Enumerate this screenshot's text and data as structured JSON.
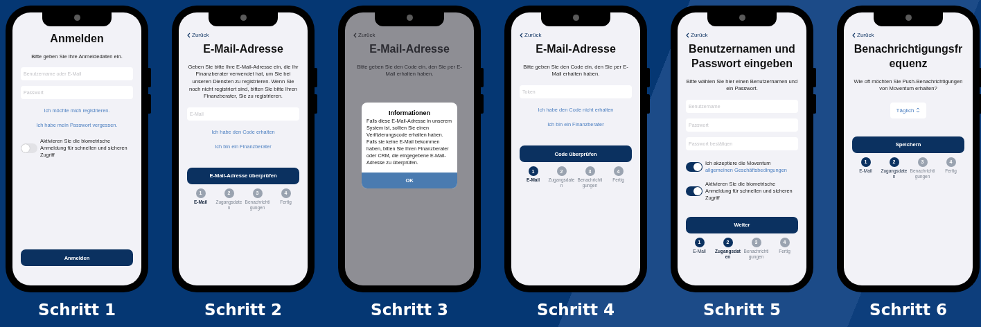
{
  "phones": [
    {
      "caption": "Schritt 1",
      "title": "Anmelden",
      "intro": "Bitte geben Sie Ihre Anmeldedaten ein.",
      "dimmed": false,
      "blocks": [
        {
          "kind": "field",
          "placeholder": "Benutzername oder E-Mail"
        },
        {
          "kind": "field",
          "placeholder": "Passwort"
        },
        {
          "kind": "link",
          "label": "Ich möchte mich registrieren."
        },
        {
          "kind": "link",
          "label": "Ich habe mein Passwort vergessen."
        },
        {
          "kind": "toggle",
          "on": false,
          "text": "Aktivieren Sie die biometrische Anmeldung für schnellen und sicheren Zugriff"
        },
        {
          "kind": "button",
          "label": "Anmelden"
        }
      ]
    },
    {
      "caption": "Schritt 2",
      "back": "Zurück",
      "title": "E-Mail-Adresse",
      "intro": "Geben Sie bitte Ihre E-Mail-Adresse ein, die Ihr Finanzberater verwendet hat, um Sie bei unseren Diensten zu registrieren. Wenn Sie noch nicht registriert sind, bitten Sie bitte Ihren Finanzberater, Sie zu registrieren.",
      "dimmed": false,
      "blocks": [
        {
          "kind": "field",
          "placeholder": "E-Mail"
        },
        {
          "kind": "link",
          "label": "Ich habe den Code erhalten"
        },
        {
          "kind": "link",
          "label": "Ich bin ein Finanzberater"
        },
        {
          "kind": "button",
          "label": "E-Mail-Adresse überprüfen"
        },
        {
          "kind": "steps",
          "steps": [
            {
              "number": "1",
              "label": "E-Mail",
              "filled": false,
              "selected": true
            },
            {
              "number": "2",
              "label": "Zugangsdaten",
              "filled": false,
              "selected": false
            },
            {
              "number": "3",
              "label": "Benachrichtigungen",
              "filled": false,
              "selected": false
            },
            {
              "number": "4",
              "label": "Fertig",
              "filled": false,
              "selected": false
            }
          ]
        }
      ]
    },
    {
      "caption": "Schritt 3",
      "back": "Zurück",
      "title": "E-Mail-Adresse",
      "intro": "Bitte geben Sie den Code ein, den Sie per E-Mail erhalten haben.",
      "dimmed": true,
      "dialog": {
        "title": "Informationen",
        "text": "Falls diese E-Mail-Adresse in unserem System ist, sollten Sie einen Verifizierungscode erhalten haben. Falls sie keine E-Mail bekommen haben, bitten Sie Ihren Finanzberater oder CRM, die eingegebene E-Mail-Adresse zu überprüfen.",
        "button": "OK"
      }
    },
    {
      "caption": "Schritt 4",
      "back": "Zurück",
      "title": "E-Mail-Adresse",
      "intro": "Bitte geben Sie den Code ein, den Sie per E-Mail erhalten haben.",
      "dimmed": false,
      "blocks": [
        {
          "kind": "field",
          "placeholder": "Token"
        },
        {
          "kind": "link",
          "label": "Ich habe den Code nicht erhalten"
        },
        {
          "kind": "link",
          "label": "Ich bin ein Finanzberater"
        },
        {
          "kind": "button",
          "label": "Code überprüfen"
        },
        {
          "kind": "steps",
          "steps": [
            {
              "number": "1",
              "label": "E-Mail",
              "filled": true,
              "selected": true
            },
            {
              "number": "2",
              "label": "Zugangsdaten",
              "filled": false,
              "selected": false
            },
            {
              "number": "3",
              "label": "Benachrichtigungen",
              "filled": false,
              "selected": false
            },
            {
              "number": "4",
              "label": "Fertig",
              "filled": false,
              "selected": false
            }
          ]
        }
      ]
    },
    {
      "caption": "Schritt 5",
      "back": "Zurück",
      "title": "Benutzernamen und Passwort eingeben",
      "intro": "Bitte wählen Sie hier einen Benutzernamen und ein Passwort.",
      "dimmed": false,
      "blocks": [
        {
          "kind": "field",
          "placeholder": "Benutzername"
        },
        {
          "kind": "field",
          "placeholder": "Passwort"
        },
        {
          "kind": "field",
          "placeholder": "Passwort bestätigen"
        },
        {
          "kind": "toggle",
          "on": true,
          "text": "Ich akzeptiere die Moventum",
          "link": "allgemeinen Geschäftsbedingungen"
        },
        {
          "kind": "toggle",
          "on": true,
          "text": "Aktivieren Sie die biometrische Anmeldung für schnellen und sicheren Zugriff"
        },
        {
          "kind": "button",
          "label": "Weiter"
        },
        {
          "kind": "steps",
          "steps": [
            {
              "number": "1",
              "label": "E-Mail",
              "filled": true,
              "selected": false
            },
            {
              "number": "2",
              "label": "Zugangsdaten",
              "filled": true,
              "selected": true
            },
            {
              "number": "3",
              "label": "Benachrichtigungen",
              "filled": false,
              "selected": false
            },
            {
              "number": "4",
              "label": "Fertig",
              "filled": false,
              "selected": false
            }
          ]
        }
      ]
    },
    {
      "caption": "Schritt 6",
      "back": "Zurück",
      "title": "Benachrichtigungsfrequenz",
      "intro": "Wie oft möchten Sie Push-Benachrichtigungen von Moventum erhalten?",
      "dimmed": false,
      "blocks": [
        {
          "kind": "select",
          "value": "Täglich"
        },
        {
          "kind": "button",
          "label": "Speichern"
        },
        {
          "kind": "steps",
          "steps": [
            {
              "number": "1",
              "label": "E-Mail",
              "filled": true,
              "selected": false
            },
            {
              "number": "2",
              "label": "Zugangsdaten",
              "filled": true,
              "selected": false
            },
            {
              "number": "3",
              "label": "Benachrichtigungen",
              "filled": false,
              "selected": false
            },
            {
              "number": "4",
              "label": "Fertig",
              "filled": false,
              "selected": false
            }
          ]
        }
      ]
    }
  ]
}
